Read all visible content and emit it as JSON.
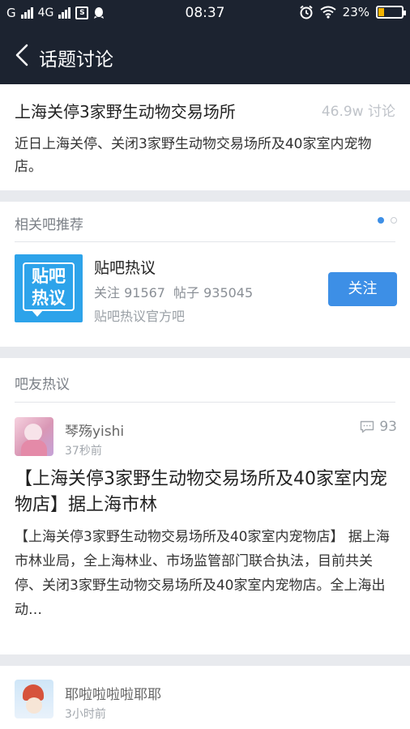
{
  "status_bar": {
    "carrier_left": "G",
    "network": "4G",
    "box_icon_text": "S",
    "time": "08:37",
    "battery_percent": "23%",
    "battery_level": 0.23,
    "icons": [
      "signal-icon",
      "sim-icon",
      "qq-icon",
      "alarm-icon",
      "wifi-icon",
      "battery-icon"
    ]
  },
  "nav": {
    "back_icon": "chevron-left-icon",
    "title": "话题讨论"
  },
  "topic": {
    "title": "上海关停3家野生动物交易场所",
    "count": "46.9w 讨论",
    "description": "近日上海关停、关闭3家野生动物交易场所及40家室内宠物店。"
  },
  "related": {
    "section_title": "相关吧推荐",
    "page_dots": {
      "total": 2,
      "active": 1
    },
    "bar": {
      "logo_text": "贴吧热议",
      "name": "贴吧热议",
      "followers": "关注 91567",
      "posts": "帖子 935045",
      "subtitle": "贴吧热议官方吧",
      "follow_label": "关注"
    }
  },
  "discussions": {
    "section_title": "吧友热议",
    "posts": [
      {
        "user": "琴殇yishi",
        "time": "37秒前",
        "comments": "93",
        "title": "【上海关停3家野生动物交易场所及40家室内宠物店】据上海市林",
        "body": "【上海关停3家野生动物交易场所及40家室内宠物店】 据上海市林业局，全上海林业、市场监管部门联合执法，目前共关停、关闭3家野生动物交易场所及40家室内宠物店。全上海出动…"
      },
      {
        "user": "耶啦啦啦啦耶耶",
        "time": "3小时前"
      }
    ]
  },
  "colors": {
    "header_bg": "#1c2330",
    "accent": "#3d8fe6",
    "logo_bg": "#2da3ea",
    "battery_fill": "#f4b400"
  }
}
